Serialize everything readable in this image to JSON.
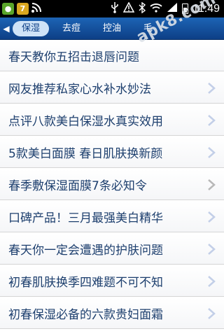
{
  "status_bar": {
    "time": "11:49",
    "icons": [
      "app-icon-green",
      "app-icon-yellow",
      "rss-icon",
      "usb-icon",
      "warning-icon",
      "bluetooth-icon",
      "wifi-icon",
      "signal-icon",
      "battery-icon"
    ]
  },
  "tabs": {
    "items": [
      "保湿",
      "去痘",
      "控油",
      "毛"
    ],
    "active_index": 0
  },
  "list": {
    "items": [
      "春天教你五招击退唇问题",
      "网友推荐私家心水补水妙法",
      "点评八款美白保湿水真实效用",
      "5款美白面膜 春日肌肤换新颜",
      "春季敷保湿面膜7条必知令",
      "口碑产品！三月最强美白精华",
      "春天你一定会遭遇的护肤问题",
      "初春肌肤换季四难题不可不知",
      "初春保湿必备的六款贵妇面霜"
    ]
  },
  "watermark": {
    "text": "apk8.com"
  },
  "colors": {
    "tab_bar": "#1d64b5",
    "active_tab": "#cfe3f7",
    "item_text": "#1d3f6e",
    "chevron": "#c3cfe8"
  }
}
